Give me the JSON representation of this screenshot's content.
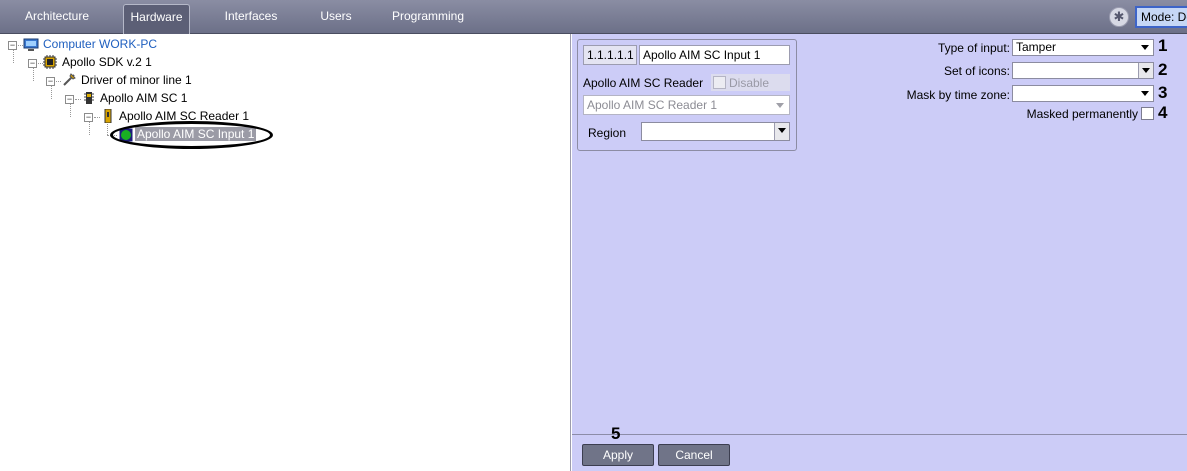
{
  "tabs": [
    {
      "label": "Architecture"
    },
    {
      "label": "Hardware"
    },
    {
      "label": "Interfaces"
    },
    {
      "label": "Users"
    },
    {
      "label": "Programming"
    }
  ],
  "mode": {
    "label": "Mode: De",
    "icon": "settings-icon"
  },
  "tree": {
    "computer": "Computer WORK-PC",
    "sdk": "Apollo SDK v.2 1",
    "driver": "Driver of minor line 1",
    "aim": "Apollo AIM SC 1",
    "reader": "Apollo AIM SC Reader 1",
    "input": "Apollo AIM SC Input 1"
  },
  "object": {
    "id": "1.1.1.1.1",
    "name": "Apollo AIM SC Input 1",
    "parent_label": "Apollo AIM SC Reader",
    "disable_label": "Disable",
    "parent_value": "Apollo AIM SC Reader 1",
    "region_label": "Region",
    "region_value": ""
  },
  "fields": {
    "type_label": "Type of input:",
    "type_value": "Tamper",
    "icons_label": "Set of icons:",
    "icons_value": "",
    "mask_label": "Mask by time zone:",
    "mask_value": "",
    "masked_label": "Masked permanently"
  },
  "callouts": [
    "1",
    "2",
    "3",
    "4",
    "5"
  ],
  "buttons": {
    "apply": "Apply",
    "cancel": "Cancel"
  },
  "colors": {
    "panel": "#ccccf7",
    "tabbar": "#6c7088",
    "computer_text": "#1f5fbf",
    "status_green": "#19b023"
  }
}
